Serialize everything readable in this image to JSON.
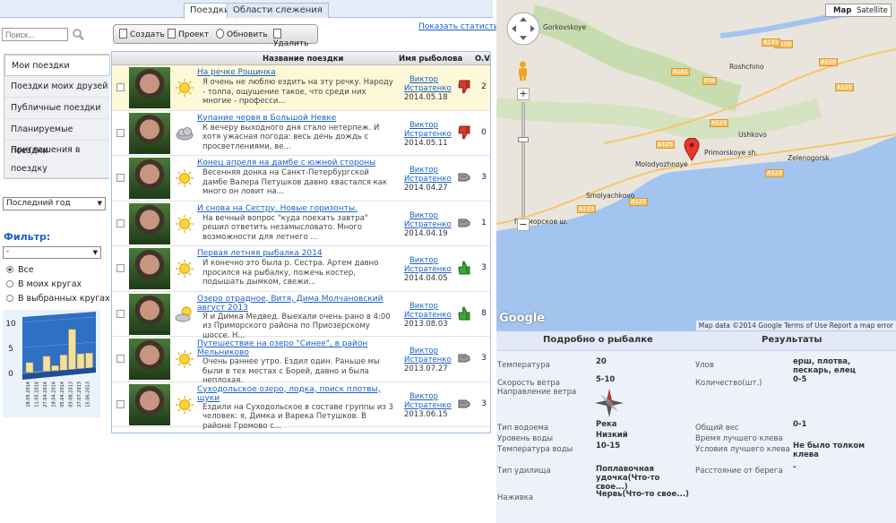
{
  "tabs": [
    {
      "label": "Поездки"
    },
    {
      "label": "Области слежения"
    }
  ],
  "search": {
    "placeholder": "Поиск..."
  },
  "menu": [
    {
      "label": "Мои поездки"
    },
    {
      "label": "Поездки моих друзей"
    },
    {
      "label": "Публичные поездки"
    },
    {
      "label": "Планируемые поездки"
    },
    {
      "label": "Приглашения в поездку"
    }
  ],
  "period": {
    "value": "Последний год"
  },
  "filter": {
    "title": "Фильтр:",
    "value": "-",
    "options": [
      {
        "label": "Все",
        "checked": true
      },
      {
        "label": "В моих кругах",
        "checked": false
      },
      {
        "label": "В выбранных кругах",
        "checked": false
      }
    ]
  },
  "toolbar": {
    "create": "Создать",
    "project": "Проект",
    "refresh": "Обновить",
    "delete": "Удалить"
  },
  "stats_link": "Показать статистику",
  "table": {
    "headers": {
      "title": "Название поездки",
      "angler": "Имя рыболова",
      "ov": "O.V."
    },
    "rows": [
      {
        "title": "На речке Рощинка",
        "desc": "Я очень не люблю ездить на эту речку. Народу - толпа, ощущение такое, что среди них многие - професси...",
        "author": "Виктор Истратенко",
        "date": "2014.05.18",
        "weather": "sun",
        "rating": "bad",
        "ov": "2",
        "highlight": true
      },
      {
        "title": "Купание червя в Большой Невке",
        "desc": "К вечеру выходного дня стало нетерпеж. И хотя ужасная погода: весь день дождь с просветлениями, ве...",
        "author": "Виктор Истратенко",
        "date": "2014.05.11",
        "weather": "cloud",
        "rating": "bad",
        "ov": "0",
        "highlight": false
      },
      {
        "title": "Конец апреля на дамбе с южной стороны",
        "desc": "Весенняя донка на Санкт-Петербургской дамбе Валера Петушков давно хвастался как много он ловит на...",
        "author": "Виктор Истратенко",
        "date": "2014.04.27",
        "weather": "sun",
        "rating": "neutral",
        "ov": "3",
        "highlight": false
      },
      {
        "title": "И снова на Сестру. Новые горизонты.",
        "desc": "На вечный вопрос \"куда поехать завтра\" решил ответить незамысловато. Много возможности для летнего ...",
        "author": "Виктор Истратенко",
        "date": "2014.04.19",
        "weather": "sun",
        "rating": "neutral",
        "ov": "1",
        "highlight": false
      },
      {
        "title": "Первая летняя рыбалка 2014",
        "desc": "И конечно это была р. Сестра. Артем давно просился на рыбалку, пожечь костер, подышать дымком, свежи...",
        "author": "Виктор Истратенко",
        "date": "2014.04.05",
        "weather": "sun",
        "rating": "good",
        "ov": "3",
        "highlight": false
      },
      {
        "title": "Озеро отрадное, Витя, Дима Молчановский август 2013",
        "desc": "Я и Димка Медвед.  Выехали очень рано в 4:00 из Приморского района по Приозерскому шоссе. Н...",
        "author": "Виктор Истратенко",
        "date": "2013.08.03",
        "weather": "suncloud",
        "rating": "good",
        "ov": "8",
        "highlight": false
      },
      {
        "title": "Путешествие на озеро \"Синее\", в район Мельниково",
        "desc": "Очень раннее утро. Ездил один. Раньше мы были в тех местах с Борей, давно и была неплохая.",
        "author": "Виктор Истратенко",
        "date": "2013.07.27",
        "weather": "sun",
        "rating": "neutral",
        "ov": "3",
        "highlight": false
      },
      {
        "title": "Суходольское озеро, лодка, поиск плотвы, щуки",
        "desc": "Ездили на Суходольское в составе группы из 3 человек: я, Димка и Варека Петушков. В районе Громово с...",
        "author": "Виктор Истратенко",
        "date": "2013.06.15",
        "weather": "sun",
        "rating": "neutral",
        "ov": "3",
        "highlight": false
      }
    ]
  },
  "mini_chart": {
    "type": "bar",
    "y_ticks": [
      "10",
      "5",
      "0"
    ],
    "dates": [
      "18.05.2014",
      "11.05.2014",
      "27.04.2014",
      "19.04.2014",
      "05.04.2014",
      "03.08.2013",
      "27.07.2013",
      "15.06.2013"
    ],
    "values": [
      2,
      0,
      3,
      1,
      3,
      8,
      3,
      3
    ]
  },
  "map": {
    "type_buttons": [
      "Map",
      "Satellite"
    ],
    "footer": "Map data ©2014 Google   Terms of Use   Report a map error",
    "logo": "Google",
    "places": [
      "Gorkovskoye",
      "Roshchino",
      "Ushkovo",
      "Zelenogorsk",
      "Molodyozhnoye",
      "Smolyachkovo",
      "Primorskoye sh.",
      "Приморское ш."
    ],
    "roads": [
      "A120",
      "A120",
      "A120",
      "A121",
      "A181",
      "P34",
      "A125",
      "A123",
      "A123",
      "A123",
      "A123"
    ]
  },
  "details": {
    "left_title": "Подробно о рыбалке",
    "right_title": "Результаты",
    "fields": [
      {
        "label": "Температура",
        "value": "20"
      },
      {
        "label": "Скорость ветра",
        "value": "5-10"
      },
      {
        "label": "Направление ветра",
        "value": ""
      },
      {
        "label": "Тип водоема",
        "value": "Река"
      },
      {
        "label": "Уровень воды",
        "value": "Низкий"
      },
      {
        "label": "Температура воды",
        "value": "10-15"
      },
      {
        "label": "Тип удилища",
        "value": "Поплавочная удочка(Что-то свое...)"
      },
      {
        "label": "Наживка",
        "value": "Червь(Что-то свое...)"
      }
    ],
    "results": [
      {
        "label": "Улов",
        "value": "ерш, плотва, пескарь, елец"
      },
      {
        "label": "Количество(шт.)",
        "value": "0-5"
      },
      {
        "label": "Общий вес",
        "value": "0-1"
      },
      {
        "label": "Время лучшего клева",
        "value": ""
      },
      {
        "label": "Условия лучшего клева",
        "value": "Не было толком клева"
      },
      {
        "label": "Расстояние от берега",
        "value": "-"
      }
    ]
  }
}
